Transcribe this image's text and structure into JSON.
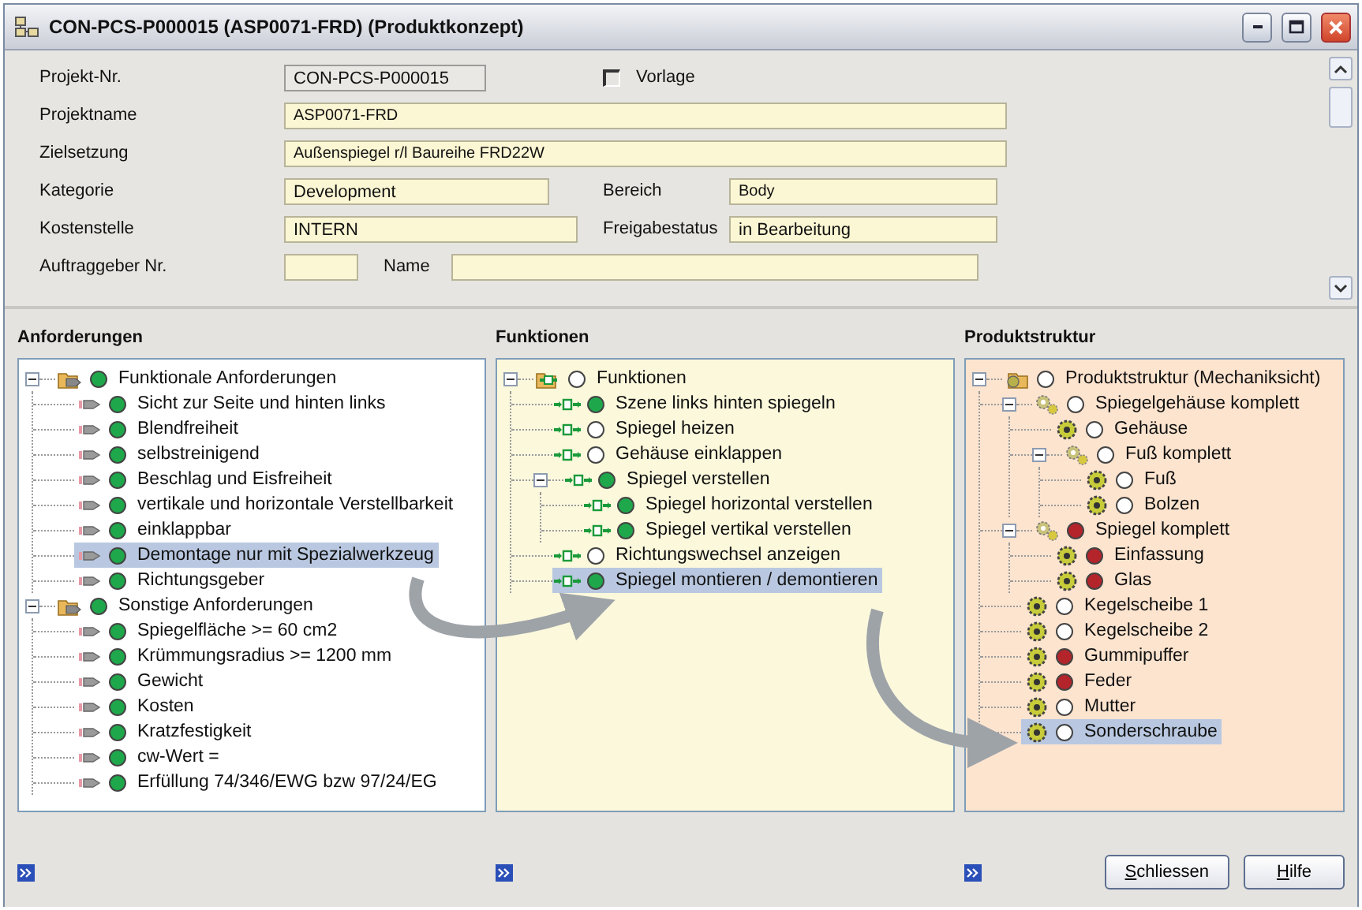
{
  "window": {
    "title": "CON-PCS-P000015 (ASP0071-FRD) (Produktkonzept)"
  },
  "form": {
    "rows": [
      [
        {
          "kind": "readonly",
          "label": "Projekt-Nr.",
          "value": "CON-PCS-P000015"
        },
        {
          "kind": "checkbox",
          "label": "Vorlage",
          "checked": false
        }
      ],
      [
        {
          "kind": "text",
          "label": "Projektname",
          "value": "ASP0071-FRD"
        }
      ],
      [
        {
          "kind": "text",
          "label": "Zielsetzung",
          "value": "Außenspiegel r/l Baureihe FRD22W"
        }
      ],
      [
        {
          "kind": "text",
          "label": "Kategorie",
          "value": "Development"
        },
        {
          "kind": "text",
          "label": "Bereich",
          "value": "Body"
        }
      ],
      [
        {
          "kind": "text",
          "label": "Kostenstelle",
          "value": "INTERN"
        },
        {
          "kind": "text",
          "label": "Freigabestatus",
          "value": "in Bearbeitung"
        }
      ],
      [
        {
          "kind": "text",
          "label": "Auftraggeber Nr."
        },
        {
          "kind": "text",
          "label": "Name"
        }
      ]
    ]
  },
  "panels": [
    {
      "title": "Anforderungen",
      "tree": [
        {
          "label": "Funktionale Anforderungen",
          "kind": "group",
          "color": "#1ea84b",
          "selected": false,
          "expanded": true,
          "children": [
            {
              "label": "Sicht zur Seite und hinten links",
              "kind": "requirement",
              "color": "#1ea84b",
              "selected": false
            },
            {
              "label": "Blendfreiheit",
              "kind": "requirement",
              "color": "#1ea84b",
              "selected": false
            },
            {
              "label": "selbstreinigend",
              "kind": "requirement",
              "color": "#1ea84b",
              "selected": false
            },
            {
              "label": "Beschlag und Eisfreiheit",
              "kind": "requirement",
              "color": "#1ea84b",
              "selected": false
            },
            {
              "label": "vertikale und horizontale Verstellbarkeit",
              "kind": "requirement",
              "color": "#1ea84b",
              "selected": false
            },
            {
              "label": "einklappbar",
              "kind": "requirement",
              "color": "#1ea84b",
              "selected": false
            },
            {
              "label": "Demontage nur mit Spezialwerkzeug",
              "kind": "requirement",
              "color": "#1ea84b",
              "selected": true
            },
            {
              "label": "Richtungsgeber",
              "kind": "requirement",
              "color": "#1ea84b",
              "selected": false
            }
          ]
        },
        {
          "label": "Sonstige Anforderungen",
          "kind": "group",
          "color": "#1ea84b",
          "selected": false,
          "expanded": true,
          "children": [
            {
              "label": "Spiegelfläche >= 60 cm2",
              "kind": "requirement",
              "color": "#1ea84b",
              "selected": false
            },
            {
              "label": "Krümmungsradius >= 1200 mm",
              "kind": "requirement",
              "color": "#1ea84b",
              "selected": false
            },
            {
              "label": "Gewicht",
              "kind": "requirement",
              "color": "#1ea84b",
              "selected": false
            },
            {
              "label": "Kosten",
              "kind": "requirement",
              "color": "#1ea84b",
              "selected": false
            },
            {
              "label": "Kratzfestigkeit",
              "kind": "requirement",
              "color": "#1ea84b",
              "selected": false
            },
            {
              "label": "cw-Wert =",
              "kind": "requirement",
              "color": "#1ea84b",
              "selected": false
            },
            {
              "label": "Erfüllung 74/346/EWG bzw 97/24/EG",
              "kind": "requirement",
              "color": "#1ea84b",
              "selected": false
            }
          ]
        }
      ]
    },
    {
      "title": "Funktionen",
      "tree": [
        {
          "label": "Funktionen",
          "kind": "function-group",
          "color": "#ffffff",
          "selected": false,
          "expanded": true,
          "children": [
            {
              "label": "Szene links hinten spiegeln",
              "kind": "function",
              "color": "#1ea84b",
              "selected": false
            },
            {
              "label": "Spiegel heizen",
              "kind": "function",
              "color": "#ffffff",
              "selected": false
            },
            {
              "label": "Gehäuse einklappen",
              "kind": "function",
              "color": "#ffffff",
              "selected": false
            },
            {
              "label": "Spiegel verstellen",
              "kind": "function",
              "color": "#1ea84b",
              "selected": false,
              "expanded": true,
              "children": [
                {
                  "label": "Spiegel horizontal verstellen",
                  "kind": "function",
                  "color": "#1ea84b",
                  "selected": false
                },
                {
                  "label": "Spiegel vertikal verstellen",
                  "kind": "function",
                  "color": "#1ea84b",
                  "selected": false
                }
              ]
            },
            {
              "label": "Richtungswechsel anzeigen",
              "kind": "function",
              "color": "#ffffff",
              "selected": false
            },
            {
              "label": "Spiegel montieren / demontieren",
              "kind": "function",
              "color": "#1ea84b",
              "selected": true
            }
          ]
        }
      ]
    },
    {
      "title": "Produktstruktur",
      "tree": [
        {
          "label": "Produktstruktur (Mechaniksicht)",
          "kind": "product",
          "color": "#ffffff",
          "selected": false,
          "expanded": true,
          "children": [
            {
              "label": "Spiegelgehäuse komplett",
              "kind": "assembly",
              "color": "#ffffff",
              "selected": false,
              "expanded": true,
              "children": [
                {
                  "label": "Gehäuse",
                  "kind": "part",
                  "color": "#ffffff",
                  "selected": false
                },
                {
                  "label": "Fuß komplett",
                  "kind": "assembly",
                  "color": "#ffffff",
                  "selected": false,
                  "expanded": true,
                  "children": [
                    {
                      "label": "Fuß",
                      "kind": "part",
                      "color": "#ffffff",
                      "selected": false
                    },
                    {
                      "label": "Bolzen",
                      "kind": "part",
                      "color": "#ffffff",
                      "selected": false
                    }
                  ]
                }
              ]
            },
            {
              "label": "Spiegel komplett",
              "kind": "assembly",
              "color": "#b3242b",
              "selected": false,
              "expanded": true,
              "children": [
                {
                  "label": "Einfassung",
                  "kind": "part",
                  "color": "#b3242b",
                  "selected": false
                },
                {
                  "label": "Glas",
                  "kind": "part",
                  "color": "#b3242b",
                  "selected": false
                }
              ]
            },
            {
              "label": "Kegelscheibe 1",
              "kind": "part",
              "color": "#ffffff",
              "selected": false
            },
            {
              "label": "Kegelscheibe 2",
              "kind": "part",
              "color": "#ffffff",
              "selected": false
            },
            {
              "label": "Gummipuffer",
              "kind": "part",
              "color": "#b3242b",
              "selected": false
            },
            {
              "label": "Feder",
              "kind": "part",
              "color": "#b3242b",
              "selected": false
            },
            {
              "label": "Mutter",
              "kind": "part",
              "color": "#ffffff",
              "selected": false
            },
            {
              "label": "Sonderschraube",
              "kind": "part",
              "color": "#ffffff",
              "selected": true
            }
          ]
        }
      ]
    }
  ],
  "buttons": [
    "Schliessen",
    "Hilfe"
  ]
}
